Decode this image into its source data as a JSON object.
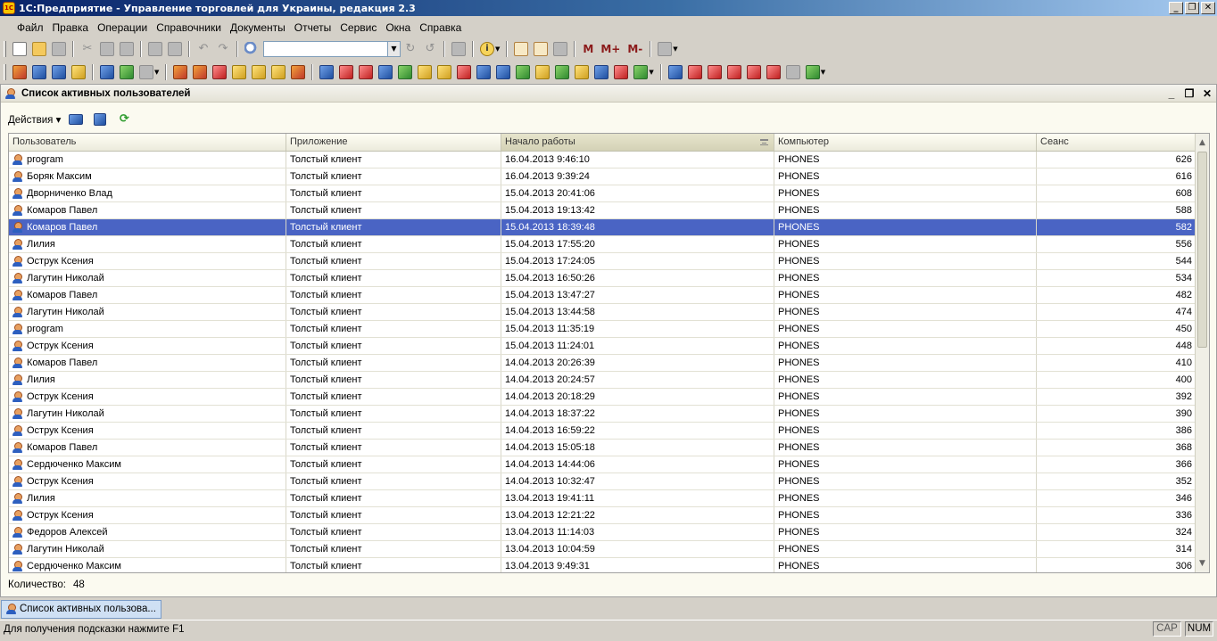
{
  "window": {
    "title": "1С:Предприятие - Управление торговлей для Украины, редакция 2.3",
    "app_icon": "1С",
    "controls": [
      "_",
      "❐",
      "✕"
    ]
  },
  "menu": [
    "Файл",
    "Правка",
    "Операции",
    "Справочники",
    "Документы",
    "Отчеты",
    "Сервис",
    "Окна",
    "Справка"
  ],
  "toolbar": {
    "search_value": "",
    "memory_buttons": [
      "M",
      "M+",
      "M-"
    ]
  },
  "document": {
    "title": "Список активных пользователей",
    "controls": [
      "_",
      "❐",
      "✕"
    ],
    "actions_label": "Действия",
    "columns": [
      "Пользователь",
      "Приложение",
      "Начало работы",
      "Компьютер",
      "Сеанс"
    ],
    "sorted_column": "Начало работы",
    "rows": [
      {
        "user": "program",
        "app": "Толстый клиент",
        "start": "16.04.2013 9:46:10",
        "computer": "PHONES",
        "session": "626"
      },
      {
        "user": "Боряк Максим",
        "app": "Толстый клиент",
        "start": "16.04.2013 9:39:24",
        "computer": "PHONES",
        "session": "616"
      },
      {
        "user": "Дворниченко Влад",
        "app": "Толстый клиент",
        "start": "15.04.2013 20:41:06",
        "computer": "PHONES",
        "session": "608"
      },
      {
        "user": "Комаров Павел",
        "app": "Толстый клиент",
        "start": "15.04.2013 19:13:42",
        "computer": "PHONES",
        "session": "588"
      },
      {
        "user": "Комаров Павел",
        "app": "Толстый клиент",
        "start": "15.04.2013 18:39:48",
        "computer": "PHONES",
        "session": "582",
        "selected": true
      },
      {
        "user": "Лилия",
        "app": "Толстый клиент",
        "start": "15.04.2013 17:55:20",
        "computer": "PHONES",
        "session": "556"
      },
      {
        "user": "Острук Ксения",
        "app": "Толстый клиент",
        "start": "15.04.2013 17:24:05",
        "computer": "PHONES",
        "session": "544"
      },
      {
        "user": "Лагутин Николай",
        "app": "Толстый клиент",
        "start": "15.04.2013 16:50:26",
        "computer": "PHONES",
        "session": "534"
      },
      {
        "user": "Комаров Павел",
        "app": "Толстый клиент",
        "start": "15.04.2013 13:47:27",
        "computer": "PHONES",
        "session": "482"
      },
      {
        "user": "Лагутин Николай",
        "app": "Толстый клиент",
        "start": "15.04.2013 13:44:58",
        "computer": "PHONES",
        "session": "474"
      },
      {
        "user": "program",
        "app": "Толстый клиент",
        "start": "15.04.2013 11:35:19",
        "computer": "PHONES",
        "session": "450"
      },
      {
        "user": "Острук Ксения",
        "app": "Толстый клиент",
        "start": "15.04.2013 11:24:01",
        "computer": "PHONES",
        "session": "448"
      },
      {
        "user": "Комаров Павел",
        "app": "Толстый клиент",
        "start": "14.04.2013 20:26:39",
        "computer": "PHONES",
        "session": "410"
      },
      {
        "user": "Лилия",
        "app": "Толстый клиент",
        "start": "14.04.2013 20:24:57",
        "computer": "PHONES",
        "session": "400"
      },
      {
        "user": "Острук Ксения",
        "app": "Толстый клиент",
        "start": "14.04.2013 20:18:29",
        "computer": "PHONES",
        "session": "392"
      },
      {
        "user": "Лагутин Николай",
        "app": "Толстый клиент",
        "start": "14.04.2013 18:37:22",
        "computer": "PHONES",
        "session": "390"
      },
      {
        "user": "Острук Ксения",
        "app": "Толстый клиент",
        "start": "14.04.2013 16:59:22",
        "computer": "PHONES",
        "session": "386"
      },
      {
        "user": "Комаров Павел",
        "app": "Толстый клиент",
        "start": "14.04.2013 15:05:18",
        "computer": "PHONES",
        "session": "368"
      },
      {
        "user": "Сердюченко Максим",
        "app": "Толстый клиент",
        "start": "14.04.2013 14:44:06",
        "computer": "PHONES",
        "session": "366"
      },
      {
        "user": "Острук Ксения",
        "app": "Толстый клиент",
        "start": "14.04.2013 10:32:47",
        "computer": "PHONES",
        "session": "352"
      },
      {
        "user": "Лилия",
        "app": "Толстый клиент",
        "start": "13.04.2013 19:41:11",
        "computer": "PHONES",
        "session": "346"
      },
      {
        "user": "Острук Ксения",
        "app": "Толстый клиент",
        "start": "13.04.2013 12:21:22",
        "computer": "PHONES",
        "session": "336"
      },
      {
        "user": "Федоров Алексей",
        "app": "Толстый клиент",
        "start": "13.04.2013 11:14:03",
        "computer": "PHONES",
        "session": "324"
      },
      {
        "user": "Лагутин Николай",
        "app": "Толстый клиент",
        "start": "13.04.2013 10:04:59",
        "computer": "PHONES",
        "session": "314"
      },
      {
        "user": "Сердюченко Максим",
        "app": "Толстый клиент",
        "start": "13.04.2013 9:49:31",
        "computer": "PHONES",
        "session": "306"
      }
    ],
    "count_label": "Количество:",
    "count_value": "48"
  },
  "taskbar": {
    "tab_label": "Список активных пользова..."
  },
  "statusbar": {
    "hint": "Для получения подсказки нажмите F1",
    "indicators": [
      "CAP",
      "NUM"
    ]
  },
  "colors": {
    "selection": "#4a64c4",
    "titlebar": "#0a246a"
  }
}
